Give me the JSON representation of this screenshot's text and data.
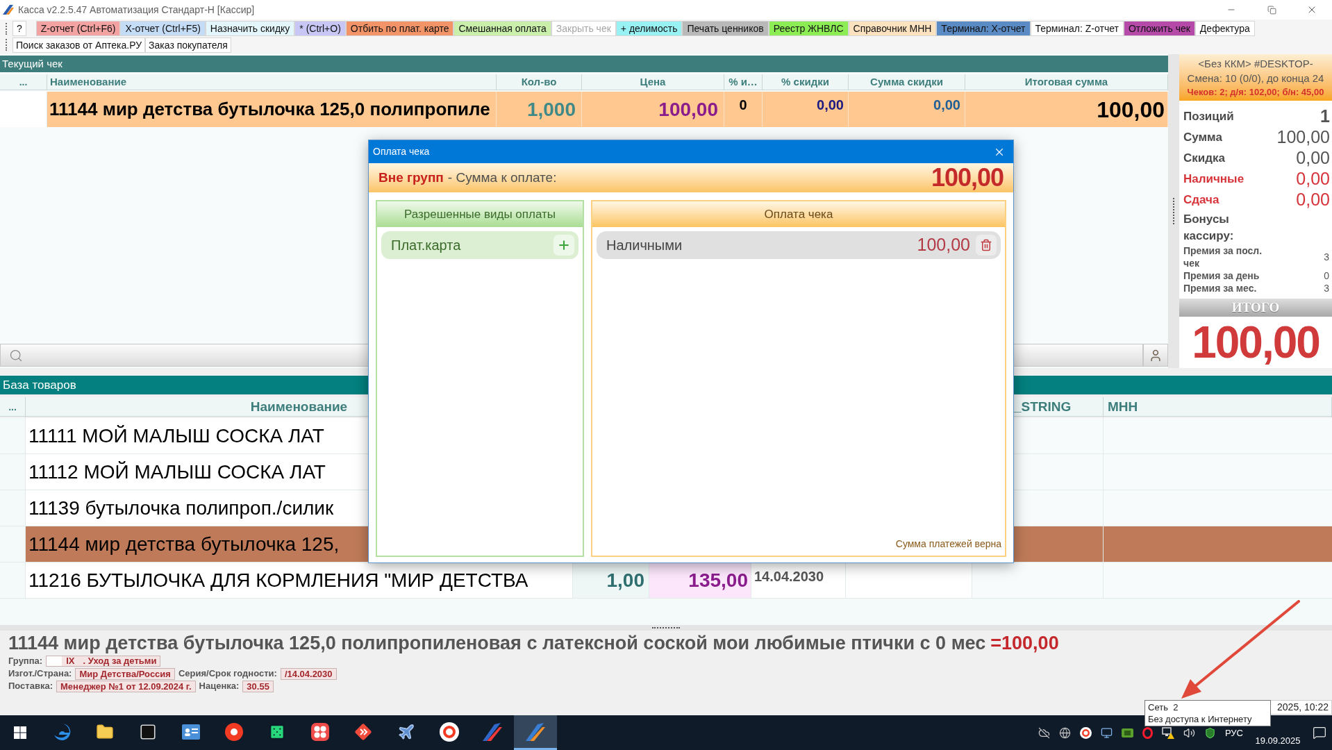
{
  "window": {
    "title": "Касса v2.2.5.47 Автоматизация Стандарт-Н [Кассир]"
  },
  "toolbar": {
    "row_1": [
      {
        "label": "?",
        "color": "#ffffff",
        "disabled": false
      },
      {
        "label": "Z-отчет (Ctrl+F6)",
        "color": "#f4a3a3",
        "disabled": false
      },
      {
        "label": "X-отчет (Ctrl+F5)",
        "color": "#c5dcf7",
        "disabled": false
      },
      {
        "label": "Назначить скидку",
        "color": "#e3f6fb",
        "disabled": false
      },
      {
        "label": "* (Ctrl+O)",
        "color": "#c7c6f4",
        "disabled": false
      },
      {
        "label": "Отбить по плат. карте",
        "color": "#f39468",
        "disabled": false
      },
      {
        "label": "Смешанная оплата",
        "color": "#c9efab",
        "disabled": false
      },
      {
        "label": "Закрыть чек",
        "color": "#ffffff",
        "disabled": true
      },
      {
        "label": "+ делимость",
        "color": "#98f1f3",
        "disabled": false
      },
      {
        "label": "Печать ценников",
        "color": "#b9b9b9",
        "disabled": false
      },
      {
        "label": "Реестр ЖНВЛС",
        "color": "#8ded55",
        "disabled": false
      },
      {
        "label": "Справочник МНН",
        "color": "#fde2bf",
        "disabled": false
      },
      {
        "label": "Терминал: X-отчет",
        "color": "#5a8bc4",
        "disabled": false
      },
      {
        "label": "Терминал: Z-отчет",
        "color": "#ffffff",
        "disabled": false
      },
      {
        "label": "Отложить чек",
        "color": "#b54aa9",
        "disabled": false
      },
      {
        "label": "Дефектура",
        "color": "#ffffff",
        "disabled": false
      }
    ],
    "row_2": [
      {
        "label": "Поиск заказов от Аптека.РУ"
      },
      {
        "label": "Заказ покупателя"
      }
    ]
  },
  "current_check": {
    "title": "Текущий чек",
    "columns": [
      "...",
      "Наименование",
      "Кол-во",
      "Цена",
      "% и…",
      "% скидки",
      "Сумма скидки",
      "Итоговая сумма"
    ],
    "rows": [
      {
        "cells": [
          "",
          "11144 мир детства бутылочка 125,0 полипропиле",
          "1,000",
          "100,00",
          "0",
          "0,00",
          "0,00",
          "100,00"
        ]
      }
    ]
  },
  "summary": {
    "device": "<Без ККМ> #DESKTOP-",
    "shift": "Смена: 10 (0/0), до конца 24",
    "receipts": "Чеков: 2; д/я: 102,00; б/н: 45,00",
    "stats": [
      {
        "label": "Позиций",
        "value": "1",
        "kind": "plain"
      },
      {
        "label": "Сумма",
        "value": "100,00",
        "kind": "plain"
      },
      {
        "label": "Скидка",
        "value": "0,00",
        "kind": "plain"
      },
      {
        "label": "Наличные",
        "value": "0,00",
        "kind": "alert"
      },
      {
        "label": "Сдача",
        "value": "0,00",
        "kind": "alert"
      }
    ],
    "bonus_title": "Бонусы кассиру:",
    "bonuses": [
      {
        "label": "Премия за посл. чек",
        "value": "3"
      },
      {
        "label": "Премия за день",
        "value": "0"
      },
      {
        "label": "Премия за мес.",
        "value": "3"
      }
    ],
    "total_label": "ИТОГО",
    "total": "100,00"
  },
  "goods_base": {
    "title": "База товаров",
    "columns": [
      "...",
      "Наименование",
      "_STRING",
      "МНН"
    ],
    "rows": [
      {
        "name": "11111 МОЙ МАЛЫШ СОСКА ЛАТ",
        "selected": false
      },
      {
        "name": "11112 МОЙ МАЛЫШ СОСКА ЛАТ",
        "selected": false
      },
      {
        "name": "11139 бутылочка полипроп./силик",
        "selected": false
      },
      {
        "name": "11144 мир детства бутылочка 125,",
        "selected": true
      },
      {
        "name": "11216 БУТЫЛОЧКА ДЛЯ КОРМЛЕНИЯ \"МИР ДЕТСТВА",
        "quantity": "1,00",
        "price": "135,00",
        "expiry": "14.04.2030",
        "selected": false
      }
    ]
  },
  "product_info": {
    "title": "11144 мир детства бутылочка 125,0 полипропиленовая с латексной соской мои любимые птички с 0 мес",
    "price": "=100,00",
    "group": {
      "label": "Группа:",
      "code": "IX",
      "name": ". Уход за детьми"
    },
    "lines": [
      [
        {
          "label": "Изгот./Страна:",
          "value": "Мир Детства/Россия"
        },
        {
          "label": "Серия/Срок годности:",
          "value": "/14.04.2030"
        }
      ],
      [
        {
          "label": "Поставка:",
          "value": "Менеджер №1 от 12.09.2024 г."
        },
        {
          "label": "Наценка:",
          "value": "30.55"
        }
      ]
    ]
  },
  "status_bar": {
    "datetime": "2025, 10:22"
  },
  "payment_dialog": {
    "title": "Оплата чека",
    "group": "Вне групп",
    "amount_label": "- Сумма к оплате:",
    "amount": "100,00",
    "allowed_title": "Разрешенные виды оплаты",
    "allowed_methods": [
      {
        "label": "Плат.карта"
      }
    ],
    "payments_title": "Оплата чека",
    "payments": [
      {
        "label": "Наличными",
        "amount": "100,00"
      }
    ],
    "status": "Сумма платежей верна"
  },
  "tooltip": {
    "lines": [
      "Сеть  2",
      "Без доступа к Интернету"
    ]
  },
  "taskbar": {
    "apps": [
      {
        "selected": false
      },
      {
        "selected": false
      },
      {
        "selected": false
      },
      {
        "selected": false
      },
      {
        "selected": false
      },
      {
        "selected": false
      },
      {
        "selected": false
      },
      {
        "selected": false
      },
      {
        "selected": false
      },
      {
        "selected": false
      },
      {
        "selected": false
      },
      {
        "selected": true
      }
    ],
    "language": "РУС",
    "date": "19.09.2025"
  }
}
